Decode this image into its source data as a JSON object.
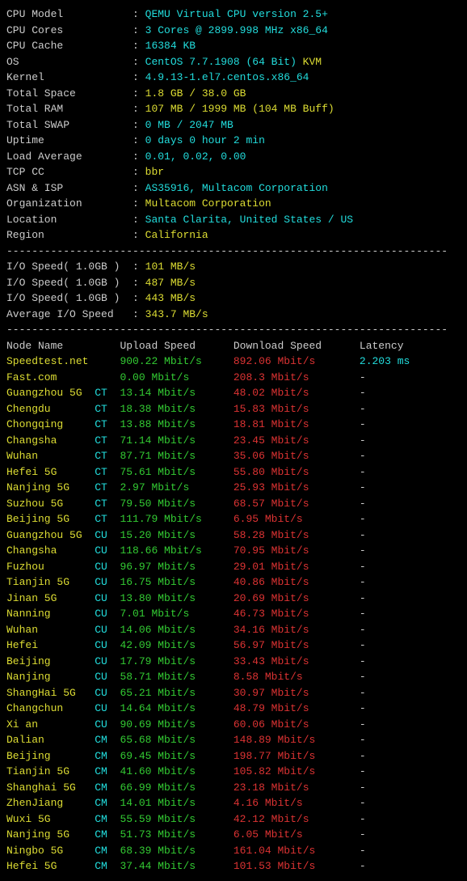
{
  "info": [
    {
      "label": "CPU Model",
      "value": "QEMU Virtual CPU version 2.5+",
      "cls": "cyan"
    },
    {
      "label": "CPU Cores",
      "value": "3 Cores @ 2899.998 MHz x86_64",
      "cls": "cyan"
    },
    {
      "label": "CPU Cache",
      "value": "16384 KB",
      "cls": "cyan"
    },
    {
      "label": "OS",
      "value": "CentOS 7.7.1908 (64 Bit)",
      "extra": " KVM",
      "cls": "cyan",
      "extracls": "yellow"
    },
    {
      "label": "Kernel",
      "value": "4.9.13-1.el7.centos.x86_64",
      "cls": "cyan"
    },
    {
      "label": "Total Space",
      "value": "1.8 GB / 38.0 GB",
      "cls": "yellow"
    },
    {
      "label": "Total RAM",
      "value": "107 MB / 1999 MB (104 MB Buff)",
      "cls": "yellow"
    },
    {
      "label": "Total SWAP",
      "value": "0 MB / 2047 MB",
      "cls": "cyan"
    },
    {
      "label": "Uptime",
      "value": "0 days 0 hour 2 min",
      "cls": "cyan"
    },
    {
      "label": "Load Average",
      "value": "0.01, 0.02, 0.00",
      "cls": "cyan"
    },
    {
      "label": "TCP CC",
      "value": "bbr",
      "cls": "yellow"
    },
    {
      "label": "ASN & ISP",
      "value": "AS35916, Multacom Corporation",
      "cls": "cyan"
    },
    {
      "label": "Organization",
      "value": "Multacom Corporation",
      "cls": "yellow"
    },
    {
      "label": "Location",
      "value": "Santa Clarita, United States / US",
      "cls": "cyan"
    },
    {
      "label": "Region",
      "value": "California",
      "cls": "yellow"
    }
  ],
  "io": [
    {
      "label": "I/O Speed( 1.0GB )",
      "value": "101 MB/s",
      "cls": "yellow"
    },
    {
      "label": "I/O Speed( 1.0GB )",
      "value": "487 MB/s",
      "cls": "yellow"
    },
    {
      "label": "I/O Speed( 1.0GB )",
      "value": "443 MB/s",
      "cls": "yellow"
    },
    {
      "label": "Average I/O Speed",
      "value": "343.7 MB/s",
      "cls": "yellow"
    }
  ],
  "speedheader": {
    "name": "Node Name",
    "upload": "Upload Speed",
    "download": "Download Speed",
    "latency": "Latency"
  },
  "speed": [
    {
      "name": "Speedtest.net",
      "tag": "",
      "up": "900.22 Mbit/s",
      "down": "892.06 Mbit/s",
      "lat": "2.203 ms",
      "namecls": "yellow",
      "latcls": "cyan"
    },
    {
      "name": "Fast.com",
      "tag": "",
      "up": "0.00 Mbit/s",
      "down": "208.3 Mbit/s",
      "lat": "-",
      "namecls": "yellow"
    },
    {
      "name": "Guangzhou 5G",
      "tag": "CT",
      "up": "13.14 Mbit/s",
      "down": "48.02 Mbit/s",
      "lat": "-",
      "namecls": "yellow"
    },
    {
      "name": "Chengdu",
      "tag": "CT",
      "up": "18.38 Mbit/s",
      "down": "15.83 Mbit/s",
      "lat": "-",
      "namecls": "yellow"
    },
    {
      "name": "Chongqing",
      "tag": "CT",
      "up": "13.88 Mbit/s",
      "down": "18.81 Mbit/s",
      "lat": "-",
      "namecls": "yellow"
    },
    {
      "name": "Changsha",
      "tag": "CT",
      "up": "71.14 Mbit/s",
      "down": "23.45 Mbit/s",
      "lat": "-",
      "namecls": "yellow"
    },
    {
      "name": "Wuhan",
      "tag": "CT",
      "up": "87.71 Mbit/s",
      "down": "35.06 Mbit/s",
      "lat": "-",
      "namecls": "yellow"
    },
    {
      "name": "Hefei 5G",
      "tag": "CT",
      "up": "75.61 Mbit/s",
      "down": "55.80 Mbit/s",
      "lat": "-",
      "namecls": "yellow"
    },
    {
      "name": "Nanjing 5G",
      "tag": "CT",
      "up": "2.97 Mbit/s",
      "down": "25.93 Mbit/s",
      "lat": "-",
      "namecls": "yellow"
    },
    {
      "name": "Suzhou 5G",
      "tag": "CT",
      "up": "79.50 Mbit/s",
      "down": "68.57 Mbit/s",
      "lat": "-",
      "namecls": "yellow"
    },
    {
      "name": "Beijing 5G",
      "tag": "CT",
      "up": "111.79 Mbit/s",
      "down": "6.95 Mbit/s",
      "lat": "-",
      "namecls": "yellow"
    },
    {
      "name": "Guangzhou 5G",
      "tag": "CU",
      "up": "15.20 Mbit/s",
      "down": "58.28 Mbit/s",
      "lat": "-",
      "namecls": "yellow"
    },
    {
      "name": "Changsha",
      "tag": "CU",
      "up": "118.66 Mbit/s",
      "down": "70.95 Mbit/s",
      "lat": "-",
      "namecls": "yellow"
    },
    {
      "name": "Fuzhou",
      "tag": "CU",
      "up": "96.97 Mbit/s",
      "down": "29.01 Mbit/s",
      "lat": "-",
      "namecls": "yellow"
    },
    {
      "name": "Tianjin 5G",
      "tag": "CU",
      "up": "16.75 Mbit/s",
      "down": "40.86 Mbit/s",
      "lat": "-",
      "namecls": "yellow"
    },
    {
      "name": "Jinan 5G",
      "tag": "CU",
      "up": "13.80 Mbit/s",
      "down": "20.69 Mbit/s",
      "lat": "-",
      "namecls": "yellow"
    },
    {
      "name": "Nanning",
      "tag": "CU",
      "up": "7.01 Mbit/s",
      "down": "46.73 Mbit/s",
      "lat": "-",
      "namecls": "yellow"
    },
    {
      "name": "Wuhan",
      "tag": "CU",
      "up": "14.06 Mbit/s",
      "down": "34.16 Mbit/s",
      "lat": "-",
      "namecls": "yellow"
    },
    {
      "name": "Hefei",
      "tag": "CU",
      "up": "42.09 Mbit/s",
      "down": "56.97 Mbit/s",
      "lat": "-",
      "namecls": "yellow"
    },
    {
      "name": "Beijing",
      "tag": "CU",
      "up": "17.79 Mbit/s",
      "down": "33.43 Mbit/s",
      "lat": "-",
      "namecls": "yellow"
    },
    {
      "name": "Nanjing",
      "tag": "CU",
      "up": "58.71 Mbit/s",
      "down": "8.58 Mbit/s",
      "lat": "-",
      "namecls": "yellow"
    },
    {
      "name": "ShangHai 5G",
      "tag": "CU",
      "up": "65.21 Mbit/s",
      "down": "30.97 Mbit/s",
      "lat": "-",
      "namecls": "yellow"
    },
    {
      "name": "Changchun",
      "tag": "CU",
      "up": "14.64 Mbit/s",
      "down": "48.79 Mbit/s",
      "lat": "-",
      "namecls": "yellow"
    },
    {
      "name": "Xi an",
      "tag": "CU",
      "up": "90.69 Mbit/s",
      "down": "60.06 Mbit/s",
      "lat": "-",
      "namecls": "yellow"
    },
    {
      "name": "Dalian",
      "tag": "CM",
      "up": "65.68 Mbit/s",
      "down": "148.89 Mbit/s",
      "lat": "-",
      "namecls": "yellow"
    },
    {
      "name": "Beijing",
      "tag": "CM",
      "up": "69.45 Mbit/s",
      "down": "198.77 Mbit/s",
      "lat": "-",
      "namecls": "yellow"
    },
    {
      "name": "Tianjin 5G",
      "tag": "CM",
      "up": "41.60 Mbit/s",
      "down": "105.82 Mbit/s",
      "lat": "-",
      "namecls": "yellow"
    },
    {
      "name": "Shanghai 5G",
      "tag": "CM",
      "up": "66.99 Mbit/s",
      "down": "23.18 Mbit/s",
      "lat": "-",
      "namecls": "yellow"
    },
    {
      "name": "ZhenJiang",
      "tag": "CM",
      "up": "14.01 Mbit/s",
      "down": "4.16 Mbit/s",
      "lat": "-",
      "namecls": "yellow"
    },
    {
      "name": "Wuxi 5G",
      "tag": "CM",
      "up": "55.59 Mbit/s",
      "down": "42.12 Mbit/s",
      "lat": "-",
      "namecls": "yellow"
    },
    {
      "name": "Nanjing 5G",
      "tag": "CM",
      "up": "51.73 Mbit/s",
      "down": "6.05 Mbit/s",
      "lat": "-",
      "namecls": "yellow"
    },
    {
      "name": "Ningbo 5G",
      "tag": "CM",
      "up": "68.39 Mbit/s",
      "down": "161.04 Mbit/s",
      "lat": "-",
      "namecls": "yellow"
    },
    {
      "name": "Hefei 5G",
      "tag": "CM",
      "up": "37.44 Mbit/s",
      "down": "101.53 Mbit/s",
      "lat": "-",
      "namecls": "yellow"
    }
  ],
  "divider": "----------------------------------------------------------------------"
}
